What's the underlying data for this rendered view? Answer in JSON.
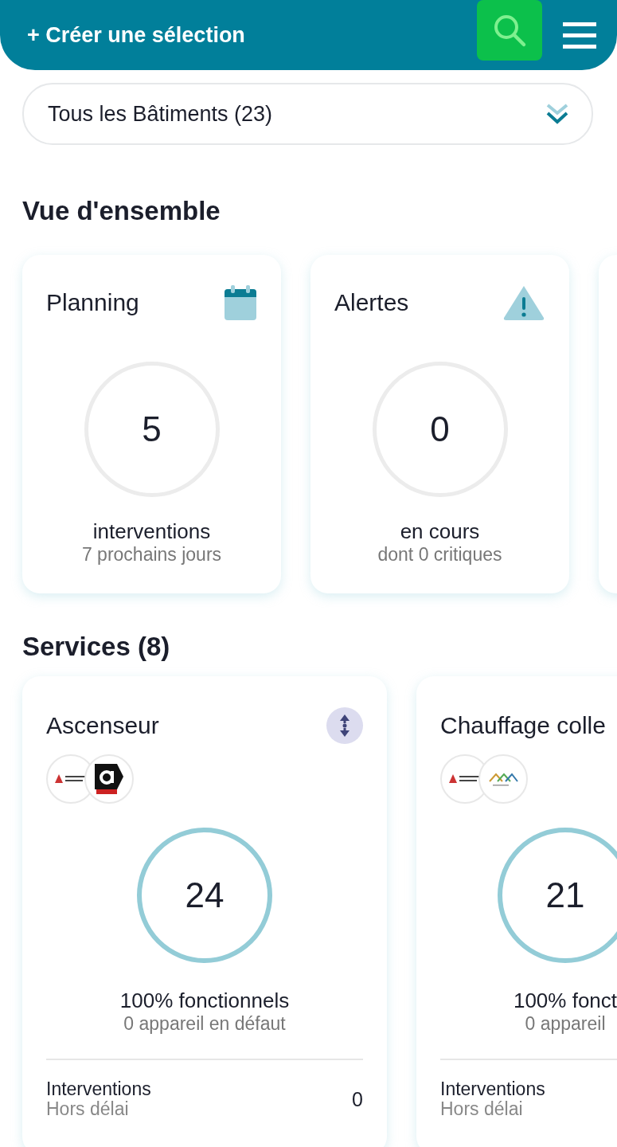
{
  "header": {
    "create_label": "+ Créer une sélection"
  },
  "building_select": {
    "value": "Tous les Bâtiments (23)"
  },
  "overview": {
    "title": "Vue d'ensemble",
    "cards": [
      {
        "kind": "planning",
        "title": "Planning",
        "count": "5",
        "label": "interventions",
        "sublabel": "7 prochains jours"
      },
      {
        "kind": "alert",
        "title": "Alertes",
        "count": "0",
        "label": "en cours",
        "sublabel": "dont 0 critiques"
      },
      {
        "kind": "empty"
      }
    ]
  },
  "services": {
    "title": "Services (8)",
    "cards": [
      {
        "title": "Ascenseur",
        "has_action": true,
        "logos": [
          {
            "kind": "elevator"
          },
          {
            "kind": "badge"
          }
        ],
        "count": "24",
        "label": "100% fonctionnels",
        "sublabel": "0 appareil en défaut",
        "row_label": "Interventions",
        "row_sublabel": "Hors délai",
        "row_value": "0"
      },
      {
        "title": "Chauffage colle",
        "has_action": false,
        "logos": [
          {
            "kind": "elevator"
          },
          {
            "kind": "roofs"
          }
        ],
        "count": "21",
        "label": "100% fonct",
        "sublabel": "0 appareil",
        "row_label": "Interventions",
        "row_sublabel": "Hors délai"
      }
    ]
  }
}
